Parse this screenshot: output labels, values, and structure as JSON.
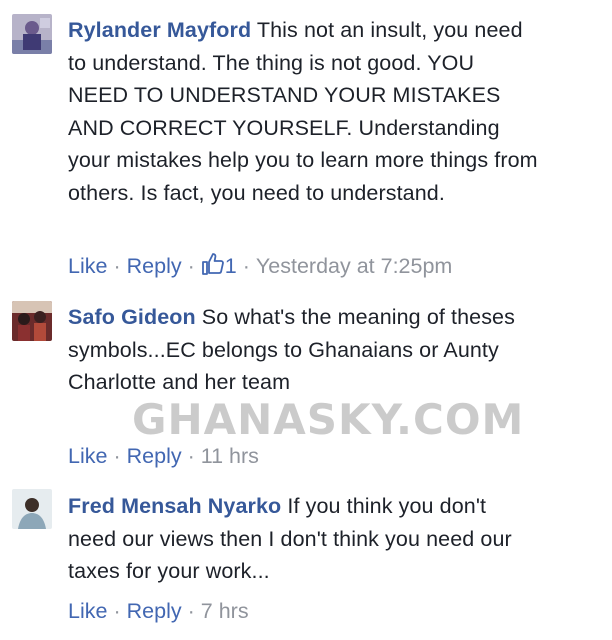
{
  "comments": [
    {
      "author": "Rylander Mayford",
      "text": "This not an insult, you need to understand. The thing is not good. YOU NEED TO UNDERSTAND YOUR MISTAKES AND CORRECT YOURSELF. Understanding your mistakes help you to learn more things from others. Is fact, you need to understand.",
      "like_label": "Like",
      "reply_label": "Reply",
      "like_count": "1",
      "timestamp": "Yesterday at 7:25pm"
    },
    {
      "author": "Safo Gideon",
      "text": "So what's the meaning of theses symbols...EC belongs to Ghanaians or Aunty Charlotte and her team",
      "like_label": "Like",
      "reply_label": "Reply",
      "timestamp": "11 hrs"
    },
    {
      "author": "Fred Mensah Nyarko",
      "text": "If you think you don't need our views then I don't think you need our taxes for your work...",
      "like_label": "Like",
      "reply_label": "Reply",
      "timestamp": "7 hrs"
    }
  ],
  "watermark": "GHANASKY.COM",
  "colors": {
    "author_link": "#365899",
    "action_link": "#4267b2",
    "meta_gray": "#90949c",
    "text": "#1d2129"
  },
  "icons": {
    "like_reaction": "thumbs-up-icon"
  }
}
